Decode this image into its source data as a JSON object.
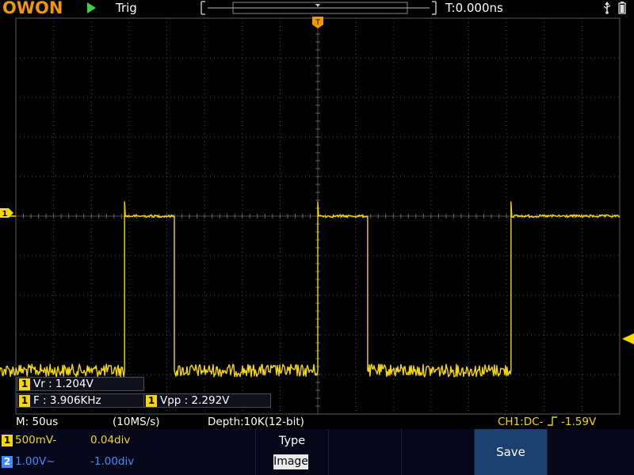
{
  "header": {
    "brand": "OWON",
    "trigger_status": "Trig",
    "time_offset": "T:0.000ns"
  },
  "colors": {
    "ch1": "#f5d800",
    "ch2": "#3c8cff",
    "brand": "#f39700",
    "trigger_marker": "#f39700",
    "run": "#3fd13f",
    "save_button": "#1b3f6e"
  },
  "icons": {
    "run": "play-triangle-icon",
    "usb": "usb-icon",
    "battery": "battery-icon",
    "trigger_position": "trigger-position-marker-icon",
    "ch1_level": "channel-1-level-marker-icon",
    "trigger_level": "trigger-level-marker-icon"
  },
  "markers": {
    "trigger_position": "T",
    "ch1_level": "1"
  },
  "measurements": [
    {
      "channel": "1",
      "text": "Vr : 1.204V"
    },
    {
      "channel": "1",
      "text": "F : 3.906KHz"
    },
    {
      "channel": "1",
      "text": "Vpp : 2.292V"
    }
  ],
  "status": {
    "timebase": "M: 50us",
    "sample_rate": "(10MS/s)",
    "depth": "Depth:10K(12-bit)",
    "trigger_info": "CH1:DC-",
    "trigger_level": "-1.59V"
  },
  "channels": [
    {
      "id": "1",
      "scale": "500mV",
      "coupling_symbol": "-",
      "offset": "0.04div"
    },
    {
      "id": "2",
      "scale": "1.00V",
      "coupling_symbol": "~",
      "offset": "-1.00div"
    }
  ],
  "menu": {
    "type_label": "Type",
    "type_value": "Image",
    "save_label": "Save"
  },
  "chart_data": {
    "type": "line",
    "series": [
      {
        "channel": "1",
        "color": "#f5d800",
        "waveform": "square",
        "frequency_khz": 3.906,
        "period_us": 256,
        "high_level_div": 0.0,
        "low_level_div": -3.9,
        "rising_edges_us": [
          -256,
          0,
          256
        ],
        "falling_edges_us": [
          -446,
          -190,
          66
        ],
        "noise_div": 0.1
      }
    ],
    "timebase_us_per_div": 50,
    "xlim_div": [
      -8,
      8
    ],
    "ylim_div": [
      -5,
      5
    ],
    "grid": true
  }
}
